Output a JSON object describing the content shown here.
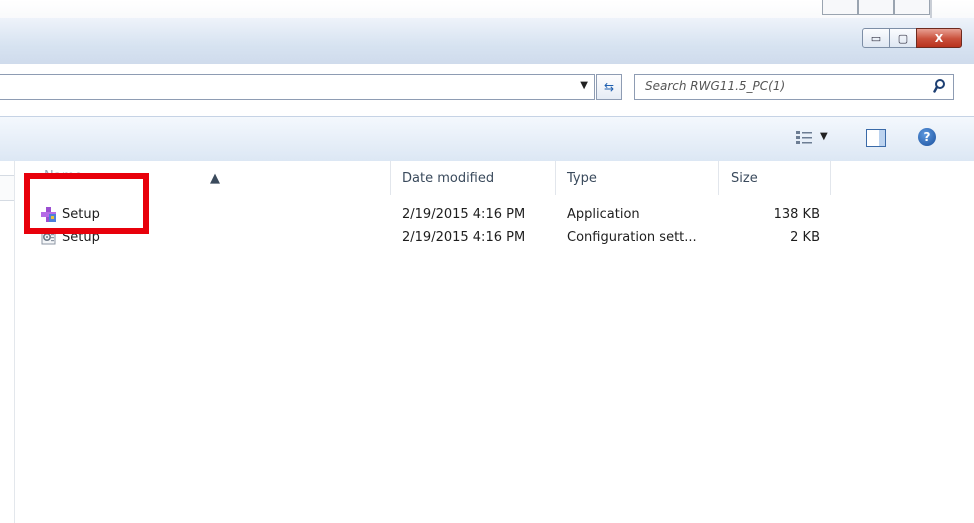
{
  "window": {
    "minimize_glyph": "▭",
    "maximize_glyph": "▢",
    "close_glyph": "X"
  },
  "address": {
    "search_placeholder": "Search RWG11.5_PC(1)"
  },
  "columns": {
    "name": "Name",
    "date_modified": "Date modified",
    "type": "Type",
    "size": "Size"
  },
  "files": [
    {
      "name": "Setup",
      "date": "2/19/2015 4:16 PM",
      "type": "Application",
      "size": "138 KB",
      "icon": "installer-icon"
    },
    {
      "name": "Setup",
      "date": "2/19/2015 4:16 PM",
      "type": "Configuration sett...",
      "size": "2 KB",
      "icon": "config-file-icon"
    }
  ],
  "colors": {
    "highlight": "#e8000b",
    "close_button": "#c9503b",
    "chrome": "#d7e3f1"
  }
}
